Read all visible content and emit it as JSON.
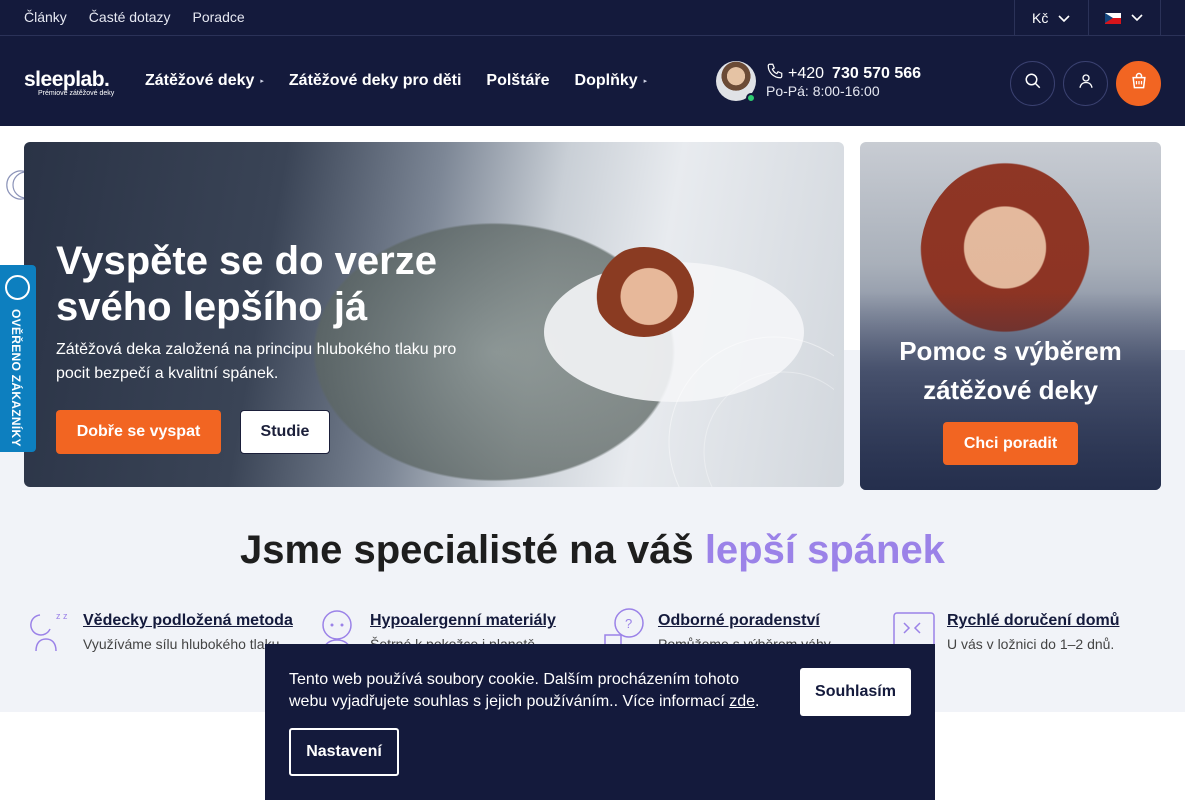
{
  "topbar": {
    "links": [
      "Články",
      "Časté dotazy",
      "Poradce"
    ],
    "currency": "Kč",
    "language_icon": "czech-flag-icon"
  },
  "header": {
    "logo": {
      "main": "sleeplab.",
      "sub": "Prémiové zátěžové deky"
    },
    "nav": [
      {
        "label": "Zátěžové deky",
        "has_dropdown": true
      },
      {
        "label": "Zátěžové deky pro děti",
        "has_dropdown": false
      },
      {
        "label": "Polštáře",
        "has_dropdown": false
      },
      {
        "label": "Doplňky",
        "has_dropdown": true
      }
    ],
    "phone_prefix": "+420",
    "phone_number": "730 570 566",
    "hours": "Po-Pá: 8:00-16:00",
    "icons": [
      "search-icon",
      "user-icon",
      "cart-icon"
    ],
    "accent_color": "#f26522",
    "bg_color": "#141a3c"
  },
  "hero": {
    "title": "Vyspěte se do verze svého lepšího já",
    "text": "Zátěžová deka založená na principu hlubokého tlaku pro pocit bezpečí a kvalitní spánek.",
    "primary_button": "Dobře se vyspat",
    "secondary_button": "Studie"
  },
  "promo_card": {
    "title": "Pomoc s výběrem zátěžové deky",
    "button": "Chci poradit"
  },
  "side_badge": {
    "text": "OVĚŘENO ZÁKAZNÍKY"
  },
  "section": {
    "title_main": "Jsme specialisté na váš",
    "title_accent": "lepší spánek",
    "accent_color": "#9b82e8",
    "features": [
      {
        "title": "Vědecky podložená metoda",
        "desc": "Využíváme sílu hlubokého tlaku",
        "icon": "sleeping-person-icon"
      },
      {
        "title": "Hypoalergenní materiály",
        "desc": "Šetrné k pokožce i planetě",
        "icon": "skincare-icon"
      },
      {
        "title": "Odborné poradenství",
        "desc": "Pomůžeme s výběrem váhy",
        "icon": "question-chat-icon"
      },
      {
        "title": "Rychlé doručení domů",
        "desc": "U vás v ložnici do 1–2 dnů.",
        "icon": "delivery-box-icon"
      }
    ]
  },
  "cookie": {
    "text": "Tento web používá soubory cookie. Dalším procházením tohoto webu vyjadřujete souhlas s jejich používáním.. Více informací",
    "link": "zde",
    "accept": "Souhlasím",
    "settings": "Nastavení"
  }
}
